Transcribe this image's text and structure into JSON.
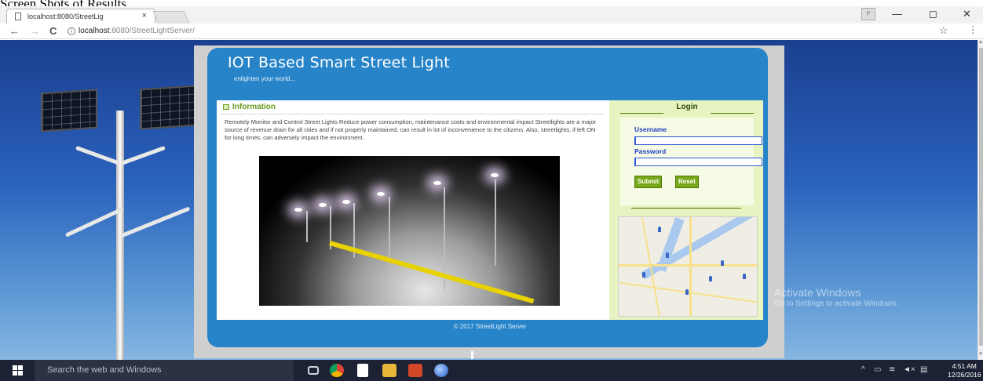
{
  "caption": "Screen Shots of Results",
  "browser": {
    "tab_title": "localhost:8080/StreetLig",
    "tab_close": "×",
    "profile": "P",
    "window_minimize": "—",
    "window_maximize": "◻",
    "window_close": "✕",
    "back": "←",
    "forward": "→",
    "reload": "C",
    "url_host": "localhost",
    "url_rest": ":8080/StreetLightServer/",
    "star": "☆",
    "menu": "⋮"
  },
  "site": {
    "title": "IOT Based Smart Street Light",
    "tagline": "enlighten your world...",
    "info_heading": "Information",
    "info_text": "Remotely Monitor and Control Street Lights Reduce power consumption, maintenance costs and environmental impact Streetlights are a major source of revenue drain for all cities and if not properly maintained, can result in lot of inconvenience to the citizens. Also, streetlights, if left ON for long times, can adversely impact the environment.",
    "footer": "© 2017 StreetLight Server"
  },
  "login": {
    "title": "Login",
    "username_label": "Username",
    "password_label": "Password",
    "username_value": "",
    "password_value": "",
    "submit_label": "Submit",
    "reset_label": "Reset"
  },
  "watermark": {
    "line1": "Activate Windows",
    "line2": "Go to Settings to activate Windows."
  },
  "taskbar": {
    "search_placeholder": "Search the web and Windows",
    "time": "4:51 AM",
    "date": "12/26/2016"
  },
  "colors": {
    "header_blue": "#2884c8",
    "login_bg": "#e7f4c2",
    "button_green": "#77a81a",
    "label_blue": "#1f3dc9"
  }
}
